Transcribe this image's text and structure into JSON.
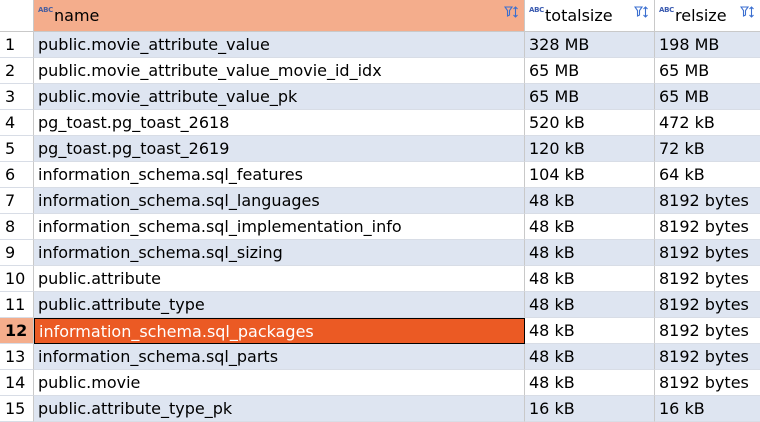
{
  "grid": {
    "columns": [
      {
        "label": "name",
        "type_icon": "abc-text-icon",
        "filter_icon": "filter-sort-icon"
      },
      {
        "label": "totalsize",
        "type_icon": "abc-text-icon",
        "filter_icon": "filter-sort-icon"
      },
      {
        "label": "relsize",
        "type_icon": "abc-text-icon",
        "filter_icon": "filter-sort-icon"
      }
    ],
    "type_icon_text": "ABC",
    "selected_row": 12,
    "rows": [
      {
        "num": "1",
        "name": "public.movie_attribute_value",
        "totalsize": "328 MB",
        "relsize": "198 MB"
      },
      {
        "num": "2",
        "name": "public.movie_attribute_value_movie_id_idx",
        "totalsize": "65 MB",
        "relsize": "65 MB"
      },
      {
        "num": "3",
        "name": "public.movie_attribute_value_pk",
        "totalsize": "65 MB",
        "relsize": "65 MB"
      },
      {
        "num": "4",
        "name": "pg_toast.pg_toast_2618",
        "totalsize": "520 kB",
        "relsize": "472 kB"
      },
      {
        "num": "5",
        "name": "pg_toast.pg_toast_2619",
        "totalsize": "120 kB",
        "relsize": "72 kB"
      },
      {
        "num": "6",
        "name": "information_schema.sql_features",
        "totalsize": "104 kB",
        "relsize": "64 kB"
      },
      {
        "num": "7",
        "name": "information_schema.sql_languages",
        "totalsize": "48 kB",
        "relsize": "8192 bytes"
      },
      {
        "num": "8",
        "name": "information_schema.sql_implementation_info",
        "totalsize": "48 kB",
        "relsize": "8192 bytes"
      },
      {
        "num": "9",
        "name": "information_schema.sql_sizing",
        "totalsize": "48 kB",
        "relsize": "8192 bytes"
      },
      {
        "num": "10",
        "name": "public.attribute",
        "totalsize": "48 kB",
        "relsize": "8192 bytes"
      },
      {
        "num": "11",
        "name": "public.attribute_type",
        "totalsize": "48 kB",
        "relsize": "8192 bytes"
      },
      {
        "num": "12",
        "name": "information_schema.sql_packages",
        "totalsize": "48 kB",
        "relsize": "8192 bytes"
      },
      {
        "num": "13",
        "name": "information_schema.sql_parts",
        "totalsize": "48 kB",
        "relsize": "8192 bytes"
      },
      {
        "num": "14",
        "name": "public.movie",
        "totalsize": "48 kB",
        "relsize": "8192 bytes"
      },
      {
        "num": "15",
        "name": "public.attribute_type_pk",
        "totalsize": "16 kB",
        "relsize": "16 kB"
      }
    ]
  },
  "colors": {
    "selected_header_bg": "#f4ad8c",
    "selected_cell_bg": "#eb5a24",
    "alt_row_bg": "#dee5f1",
    "type_icon_color": "#3b5bb0"
  }
}
